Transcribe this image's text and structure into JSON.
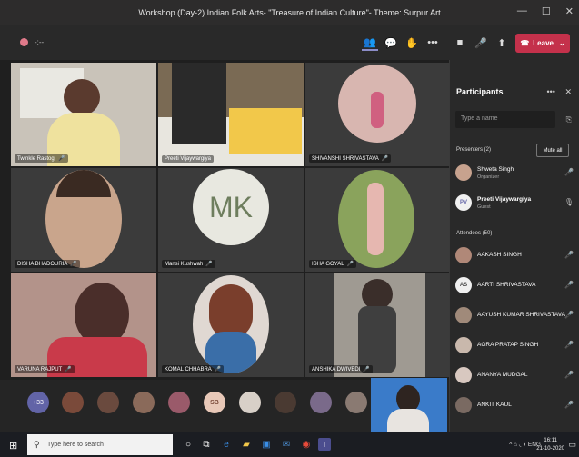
{
  "window": {
    "title": "Workshop (Day-2) Indian Folk Arts- \"Treasure of Indian Culture\"- Theme: Surpur Art",
    "controls": {
      "minimize": "—",
      "maximize": "☐",
      "close": "✕"
    }
  },
  "toolbar": {
    "timer": "-:--",
    "leave_label": "Leave"
  },
  "grid": [
    {
      "name": "Twinkle Rastogi",
      "mic": "mic-off-icon"
    },
    {
      "name": "Preeti Vijaywargiya",
      "mic": ""
    },
    {
      "name": "SHIVANSHI SHRIVASTAVA",
      "mic": "mic-off-icon"
    },
    {
      "name": "DISHA BHADOURIA",
      "mic": "mic-off-icon"
    },
    {
      "name": "Mansi Kushwah",
      "mic": "mic-off-icon",
      "initials": "MK"
    },
    {
      "name": "ISHA GOYAL",
      "mic": "mic-off-icon"
    },
    {
      "name": "VARUNA RAJPUT",
      "mic": "mic-off-icon"
    },
    {
      "name": "KOMAL CHHABRA",
      "mic": "mic-off-icon"
    },
    {
      "name": "ANSHIKA DWIVEDI",
      "mic": "mic-off-icon"
    }
  ],
  "strip": {
    "overflow_count": "+33",
    "initials_badge": "SB"
  },
  "panel": {
    "title": "Participants",
    "more": "•••",
    "close": "✕",
    "search_placeholder": "Type a name",
    "presenters_label": "Presenters (2)",
    "mute_all": "Mute all",
    "presenters": [
      {
        "name": "Shweta Singh",
        "role": "Organizer"
      },
      {
        "name": "Preeti Vijaywargiya",
        "role": "Guest",
        "initials": "PV"
      }
    ],
    "attendees_label": "Attendees (50)",
    "attendees": [
      {
        "name": "AAKASH SINGH"
      },
      {
        "name": "AARTI SHRIVASTAVA",
        "initials": "AS"
      },
      {
        "name": "AAYUSH KUMAR SHRIVASTAVA"
      },
      {
        "name": "AGRA PRATAP SINGH"
      },
      {
        "name": "ANANYA MUDGAL"
      },
      {
        "name": "ANKIT KAUL"
      }
    ]
  },
  "taskbar": {
    "search_placeholder": "Type here to search",
    "lang": "ENG",
    "time": "16:11",
    "date": "21-10-2020"
  },
  "colors": {
    "accent": "#8b8cc7",
    "leave": "#c4314b",
    "mk_avatar": "#e8e8e0"
  }
}
